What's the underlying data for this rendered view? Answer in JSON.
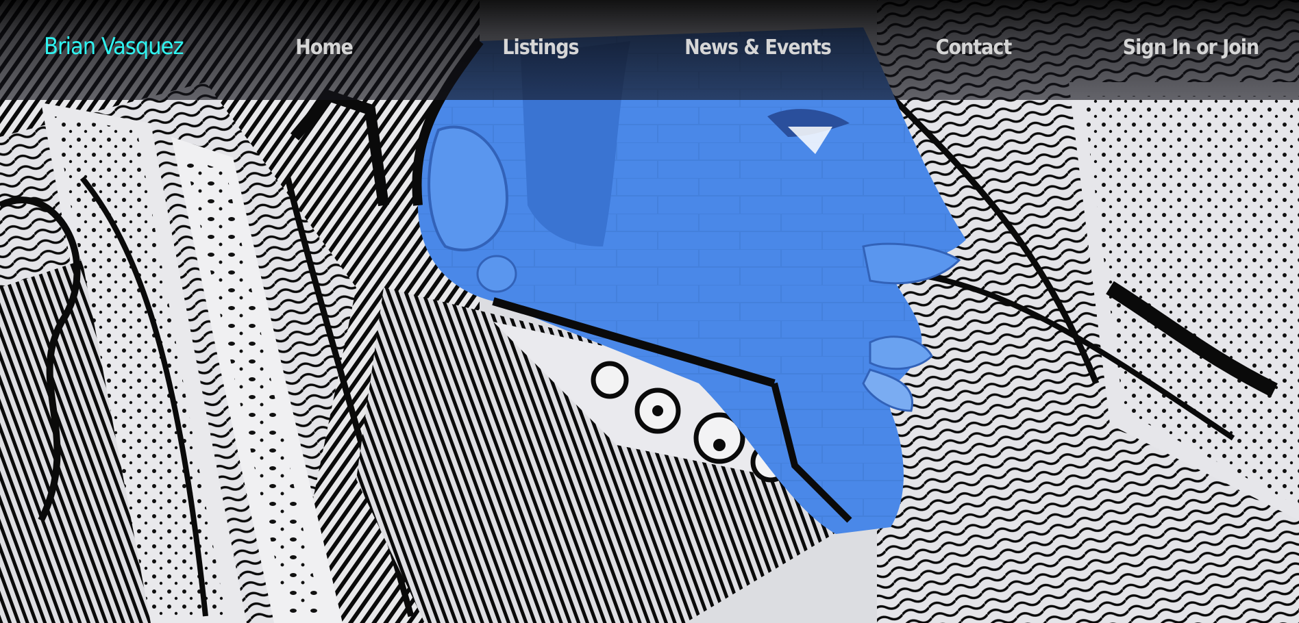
{
  "brand": {
    "name": "Brian Vasquez",
    "color": "#2ff3f0"
  },
  "nav": {
    "home": "Home",
    "listings": "Listings",
    "news_events": "News & Events",
    "contact": "Contact",
    "sign_in": "Sign In or Join"
  },
  "hero": {
    "image": "street-art-mural-blue-face-profile",
    "accent_color": "#4a88e8"
  }
}
